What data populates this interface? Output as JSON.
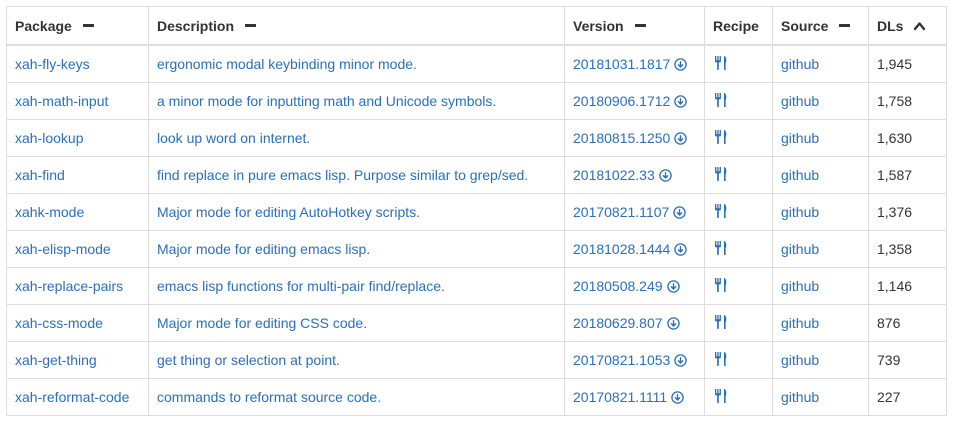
{
  "colors": {
    "link": "#2a6fb8",
    "text": "#333333",
    "border": "#dddddd"
  },
  "table": {
    "headers": {
      "package": "Package",
      "description": "Description",
      "version": "Version",
      "recipe": "Recipe",
      "source": "Source",
      "dls": "DLs"
    },
    "sort_state": {
      "package": "minus-icon",
      "description": "minus-icon",
      "version": "minus-icon",
      "source": "minus-icon",
      "dls": "caret-up-icon"
    },
    "rows": [
      {
        "package": "xah-fly-keys",
        "description": "ergonomic modal keybinding minor mode.",
        "version": "20181031.1817",
        "source": "github",
        "dls": "1,945"
      },
      {
        "package": "xah-math-input",
        "description": "a minor mode for inputting math and Unicode symbols.",
        "version": "20180906.1712",
        "source": "github",
        "dls": "1,758"
      },
      {
        "package": "xah-lookup",
        "description": "look up word on internet.",
        "version": "20180815.1250",
        "source": "github",
        "dls": "1,630"
      },
      {
        "package": "xah-find",
        "description": "find replace in pure emacs lisp. Purpose similar to grep/sed.",
        "version": "20181022.33",
        "source": "github",
        "dls": "1,587"
      },
      {
        "package": "xahk-mode",
        "description": "Major mode for editing AutoHotkey scripts.",
        "version": "20170821.1107",
        "source": "github",
        "dls": "1,376"
      },
      {
        "package": "xah-elisp-mode",
        "description": "Major mode for editing emacs lisp.",
        "version": "20181028.1444",
        "source": "github",
        "dls": "1,358"
      },
      {
        "package": "xah-replace-pairs",
        "description": "emacs lisp functions for multi-pair find/replace.",
        "version": "20180508.249",
        "source": "github",
        "dls": "1,146"
      },
      {
        "package": "xah-css-mode",
        "description": "Major mode for editing CSS code.",
        "version": "20180629.807",
        "source": "github",
        "dls": "876"
      },
      {
        "package": "xah-get-thing",
        "description": "get thing or selection at point.",
        "version": "20170821.1053",
        "source": "github",
        "dls": "739"
      },
      {
        "package": "xah-reformat-code",
        "description": "commands to reformat source code.",
        "version": "20170821.1111",
        "source": "github",
        "dls": "227"
      }
    ]
  }
}
